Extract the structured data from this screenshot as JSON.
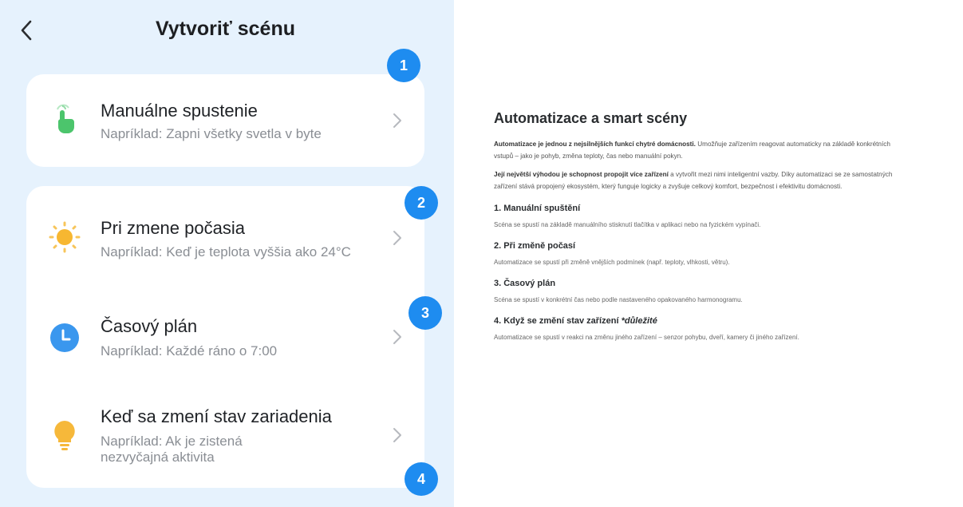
{
  "app": {
    "title": "Vytvoriť scénu"
  },
  "cards": [
    {
      "icon": "tap-hand-icon",
      "title": "Manuálne spustenie",
      "subtitle": "Napríklad: Zapni všetky svetla v byte"
    },
    {
      "icon": "sun-icon",
      "title": "Pri zmene počasia",
      "subtitle": "Napríklad: Keď je teplota vyššia ako 24°C"
    },
    {
      "icon": "clock-icon",
      "title": "Časový plán",
      "subtitle": "Napríklad: Každé ráno o 7:00"
    },
    {
      "icon": "lightbulb-icon",
      "title": "Keď sa zmení stav zariadenia",
      "subtitle_line1": "Napríklad: Ak je zistená",
      "subtitle_line2": "nezvyčajná aktivita"
    }
  ],
  "badges": [
    "1",
    "2",
    "3",
    "4"
  ],
  "doc": {
    "title": "Automatizace a smart scény",
    "intro1_bold": "Automatizace je jednou z nejsilnějších funkcí chytré domácnosti.",
    "intro1_rest": " Umožňuje zařízením reagovat automaticky na základě konkrétních vstupů – jako je pohyb, změna teploty, čas nebo manuální pokyn.",
    "intro2_bold": "Její největší výhodou je schopnost propojit více zařízení",
    "intro2_rest": " a vytvořit mezi nimi inteligentní vazby. Díky automatizaci se ze samostatných zařízení stává propojený ekosystém, který funguje logicky a zvyšuje celkový komfort, bezpečnost i efektivitu domácnosti.",
    "sections": [
      {
        "heading": "1. Manuální spuštění",
        "text": "Scéna se spustí na základě manuálního stisknutí tlačítka v aplikaci nebo na fyzickém vypínači."
      },
      {
        "heading": "2. Při změně počasí",
        "text": "Automatizace se spustí při změně vnějších podmínek (např. teploty, vlhkosti, větru)."
      },
      {
        "heading": "3. Časový plán",
        "text": "Scéna se spustí v konkrétní čas nebo podle nastaveného opakovaného harmonogramu."
      },
      {
        "heading": "4. Když se změní stav zařízení ",
        "heading_emph": "*důležité",
        "text": "Automatizace se spustí v reakci na změnu jiného zařízení – senzor pohybu, dveří, kamery či jiného zařízení."
      }
    ]
  },
  "colors": {
    "panel_bg": "#e6f2fd",
    "badge": "#1e8cf0",
    "hand": "#4cc56c",
    "sun": "#f7b731",
    "clock": "#3a97ee",
    "bulb": "#f6b83a"
  }
}
